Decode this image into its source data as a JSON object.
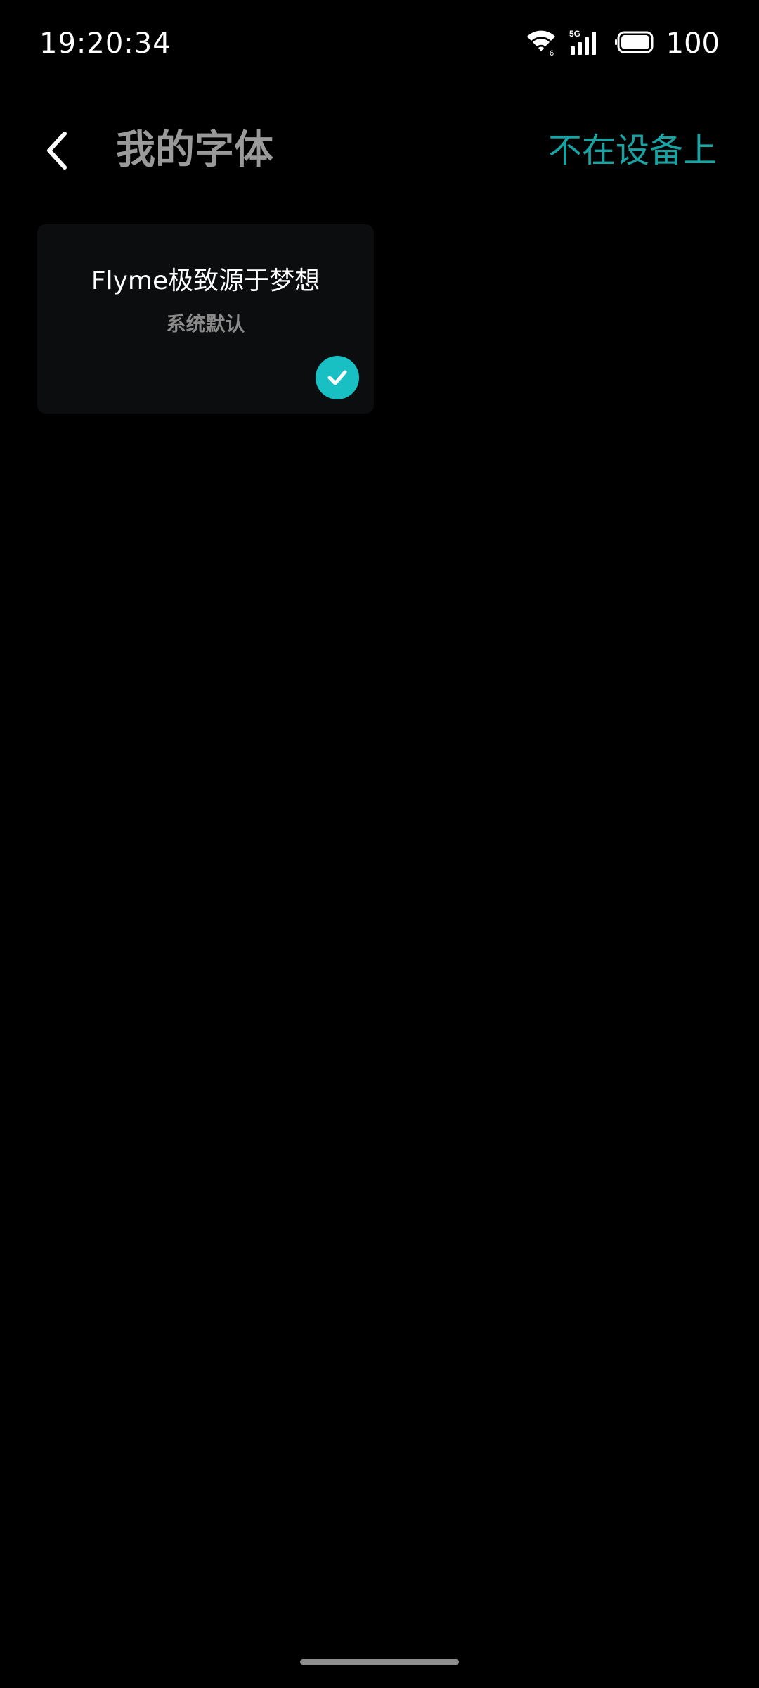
{
  "status_bar": {
    "time": "19:20:34",
    "battery_level": "100",
    "wifi_badge": "6",
    "network_type": "5G",
    "icons": [
      "wifi-icon",
      "signal-5g-icon",
      "battery-icon"
    ]
  },
  "header": {
    "title": "我的字体",
    "action_label": "不在设备上",
    "back_icon": "chevron-left-icon"
  },
  "font_list": {
    "items": [
      {
        "preview_text": "Flyme极致源于梦想",
        "name": "系统默认",
        "selected": true
      }
    ]
  },
  "colors": {
    "background": "#000000",
    "accent": "#1aa3a3",
    "check_badge": "#18c0c3",
    "card": "#0c0d0f",
    "title_text": "#9a9a9a"
  }
}
